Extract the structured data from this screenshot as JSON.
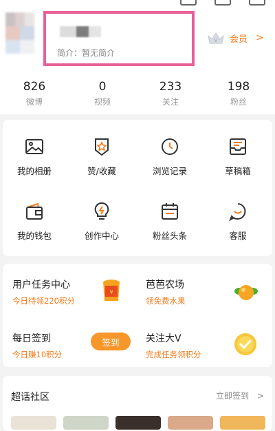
{
  "profile": {
    "bio": "简介：暂无简介",
    "member_label": "会员",
    "member_chevron": ">"
  },
  "stats": [
    {
      "value": "826",
      "label": "微博"
    },
    {
      "value": "0",
      "label": "视频"
    },
    {
      "value": "233",
      "label": "关注"
    },
    {
      "value": "198",
      "label": "粉丝"
    }
  ],
  "grid": [
    {
      "label": "我的相册",
      "icon": "photo-album-icon"
    },
    {
      "label": "赞/收藏",
      "icon": "like-collection-icon"
    },
    {
      "label": "浏览记录",
      "icon": "history-clock-icon"
    },
    {
      "label": "草稿箱",
      "icon": "drafts-inbox-icon"
    },
    {
      "label": "我的钱包",
      "icon": "wallet-icon"
    },
    {
      "label": "创作中心",
      "icon": "lightbulb-icon"
    },
    {
      "label": "粉丝头条",
      "icon": "headline-calendar-icon"
    },
    {
      "label": "客服",
      "icon": "customer-service-icon"
    }
  ],
  "tasks": {
    "user_task": {
      "title": "用户任务中心",
      "subtitle": "今日待领220积分"
    },
    "farm": {
      "title": "芭芭农场",
      "subtitle": "领免费水果"
    },
    "daily": {
      "title": "每日签到",
      "subtitle": "今日赚10积分",
      "button": "签到"
    },
    "follow_v": {
      "title": "关注大V",
      "subtitle": "完成任务领积分"
    }
  },
  "chaohua": {
    "title": "超话社区",
    "link": "立即签到",
    "chevron": ">"
  },
  "colors": {
    "accent": "#f07a1a",
    "highlight_border": "#e8609a",
    "signin_button": "#f7962a"
  }
}
